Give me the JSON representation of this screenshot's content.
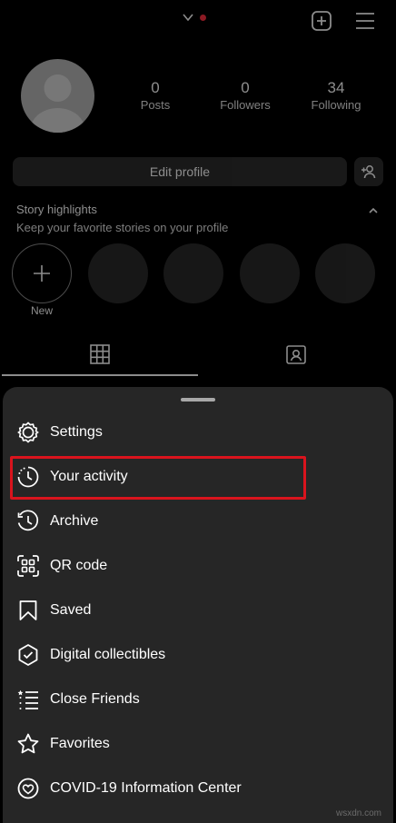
{
  "header": {
    "notification_color": "#ff3040",
    "icons": [
      "chevron-down-icon",
      "new-post-icon",
      "hamburger-menu-icon"
    ]
  },
  "profile": {
    "stats": [
      {
        "value": "0",
        "label": "Posts"
      },
      {
        "value": "0",
        "label": "Followers"
      },
      {
        "value": "34",
        "label": "Following"
      }
    ],
    "edit_profile_label": "Edit profile"
  },
  "highlights": {
    "title": "Story highlights",
    "subtitle": "Keep your favorite stories on your profile",
    "new_label": "New"
  },
  "sheet": {
    "items": [
      {
        "label": "Settings",
        "icon": "settings-gear-icon"
      },
      {
        "label": "Your activity",
        "icon": "activity-clock-icon"
      },
      {
        "label": "Archive",
        "icon": "archive-icon"
      },
      {
        "label": "QR code",
        "icon": "qr-code-icon"
      },
      {
        "label": "Saved",
        "icon": "bookmark-icon"
      },
      {
        "label": "Digital collectibles",
        "icon": "collectibles-badge-icon"
      },
      {
        "label": "Close Friends",
        "icon": "close-friends-list-icon"
      },
      {
        "label": "Favorites",
        "icon": "star-icon"
      },
      {
        "label": "COVID-19 Information Center",
        "icon": "covid-info-icon"
      }
    ],
    "highlight_color": "#d9141d"
  },
  "watermark": "wsxdn.com"
}
